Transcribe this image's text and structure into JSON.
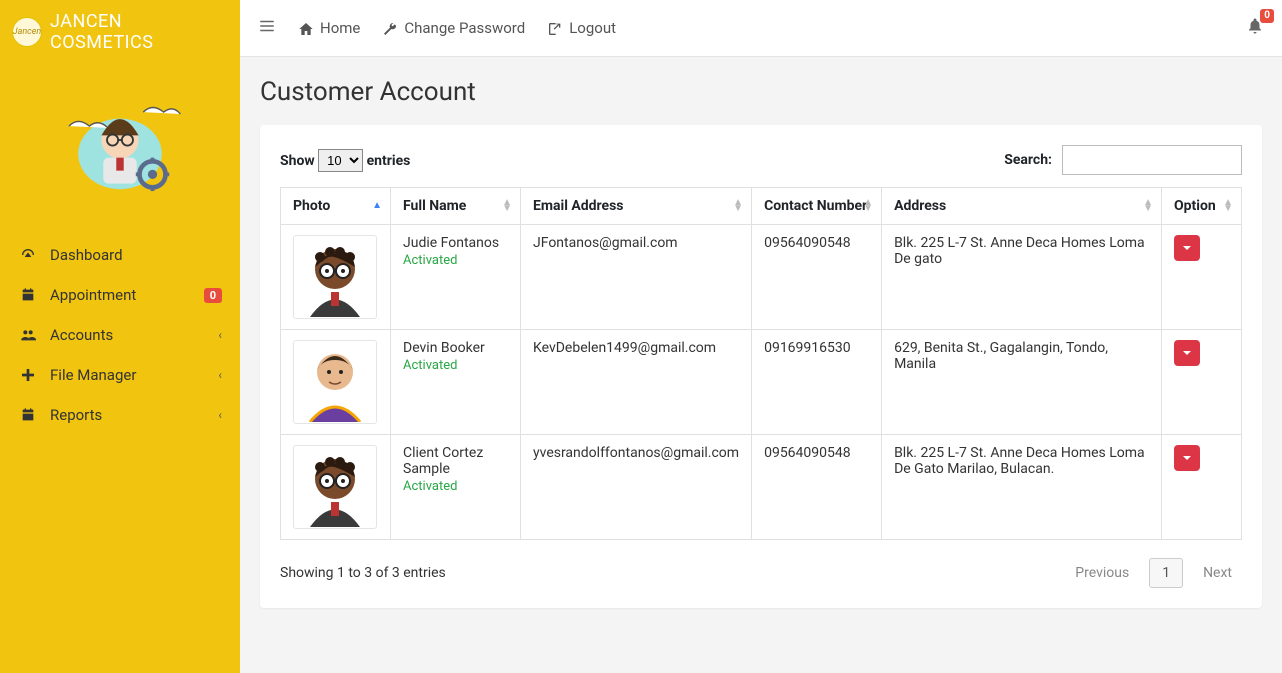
{
  "brand": {
    "title": "JANCEN COSMETICS",
    "logo_text": "Jancen"
  },
  "topbar": {
    "home": "Home",
    "change_password": "Change Password",
    "logout": "Logout",
    "bell_badge": "0"
  },
  "sidebar": {
    "items": [
      {
        "icon": "tachometer",
        "label": "Dashboard"
      },
      {
        "icon": "calendar",
        "label": "Appointment",
        "badge": "0"
      },
      {
        "icon": "users",
        "label": "Accounts",
        "caret": true
      },
      {
        "icon": "plus",
        "label": "File Manager",
        "caret": true
      },
      {
        "icon": "calendar",
        "label": "Reports",
        "caret": true
      }
    ]
  },
  "page": {
    "title": "Customer Account",
    "length_label_pre": "Show",
    "length_label_post": "entries",
    "length_value": "10",
    "search_label": "Search:",
    "columns": [
      "Photo",
      "Full Name",
      "Email Address",
      "Contact Number",
      "Address",
      "Option"
    ],
    "rows": [
      {
        "full_name": "Judie Fontanos",
        "status": "Activated",
        "email": "JFontanos@gmail.com",
        "contact": "09564090548",
        "address": "Blk. 225 L-7 St. Anne Deca Homes Loma De gato",
        "avatar": "avatar1"
      },
      {
        "full_name": "Devin Booker",
        "status": "Activated",
        "email": "KevDebelen1499@gmail.com",
        "contact": "09169916530",
        "address": "629, Benita St., Gagalangin, Tondo, Manila",
        "avatar": "avatar2"
      },
      {
        "full_name": "Client Cortez Sample",
        "status": "Activated",
        "email": "yvesrandolffontanos@gmail.com",
        "contact": "09564090548",
        "address": "Blk. 225 L-7 St. Anne Deca Homes Loma De Gato Marilao, Bulacan.",
        "avatar": "avatar1"
      }
    ],
    "info": "Showing 1 to 3 of 3 entries",
    "prev": "Previous",
    "page_num": "1",
    "next": "Next"
  }
}
